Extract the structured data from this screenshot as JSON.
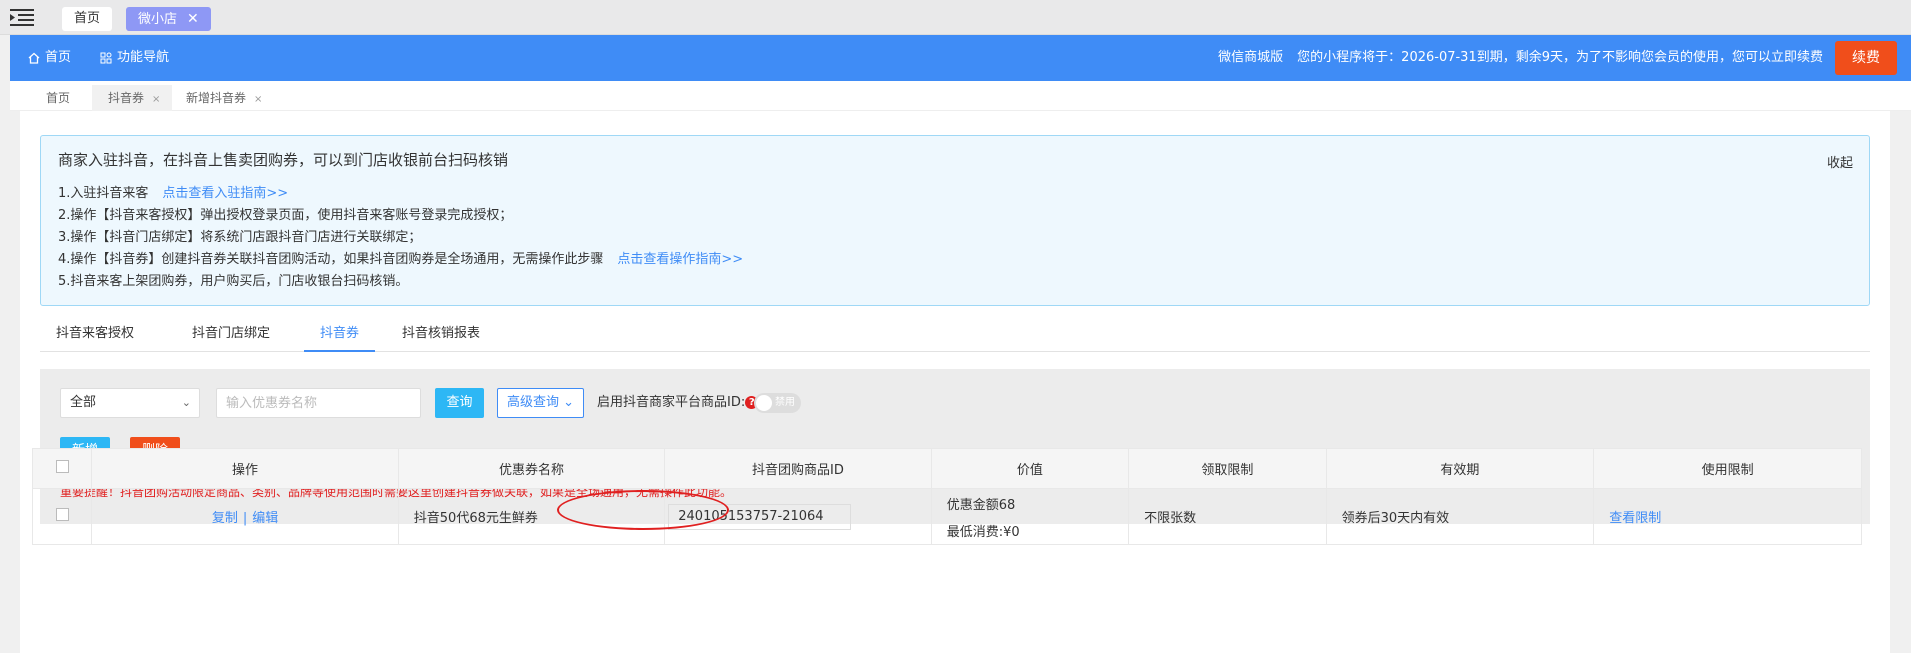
{
  "window_tabs": [
    {
      "label": "首页"
    },
    {
      "label": "微小店",
      "close": "✕"
    }
  ],
  "header": {
    "home": "首页",
    "func_nav": "功能导航",
    "version": "微信商城版",
    "notice": "您的小程序将于：2026-07-31到期，剩余9天，为了不影响您会员的使用，您可以立即续费",
    "renew": "续费"
  },
  "crumbs": [
    {
      "label": "首页"
    },
    {
      "label": "抖音券",
      "close": "×"
    },
    {
      "label": "新增抖音券",
      "close": "×"
    }
  ],
  "guide": {
    "title": "商家入驻抖音，在抖音上售卖团购券，可以到门店收银前台扫码核销",
    "collapse": "收起",
    "line1": "1.入驻抖音来客",
    "line1_link": "点击查看入驻指南>>",
    "line2": "2.操作【抖音来客授权】弹出授权登录页面，使用抖音来客账号登录完成授权；",
    "line3": "3.操作【抖音门店绑定】将系统门店跟抖音门店进行关联绑定；",
    "line4": "4.操作【抖音券】创建抖音券关联抖音团购活动，如果抖音团购券是全场通用，无需操作此步骤",
    "line4_link": "点击查看操作指南>>",
    "line5": "5.抖音来客上架团购券，用户购买后，门店收银台扫码核销。"
  },
  "tabs": [
    "抖音来客授权",
    "抖音门店绑定",
    "抖音券",
    "抖音核销报表"
  ],
  "active_tab": "抖音券",
  "filter": {
    "select_value": "全部",
    "search_placeholder": "输入优惠券名称",
    "query": "查询",
    "advanced": "高级查询",
    "enable_label": "启用抖音商家平台商品ID:",
    "help": "?",
    "toggle_label": "禁用",
    "toggle_on": false,
    "add": "新增",
    "delete": "删除",
    "warning": "重要提醒！抖音团购活动限定商品、类别、品牌等使用范围时需要这里创建抖音券做关联，如果是全场通用，无需操作此功能。"
  },
  "table": {
    "headers": [
      "操作",
      "优惠券名称",
      "抖音团购商品ID",
      "价值",
      "领取限制",
      "有效期",
      "使用限制"
    ],
    "rows": [
      {
        "op_copy": "复制",
        "op_sep": "|",
        "op_edit": "编辑",
        "name": "抖音50代68元生鲜券",
        "product_id": "240105153757-21064",
        "value_line1": "优惠金额68",
        "value_line2": "最低消费:¥0",
        "limit": "不限张数",
        "validity": "领券后30天内有效",
        "usage": "查看限制"
      }
    ]
  },
  "colors": {
    "primary": "#3f8cf6",
    "danger": "#f04e1b",
    "info": "#2db7f5",
    "active_tab": "#8e98f5"
  }
}
